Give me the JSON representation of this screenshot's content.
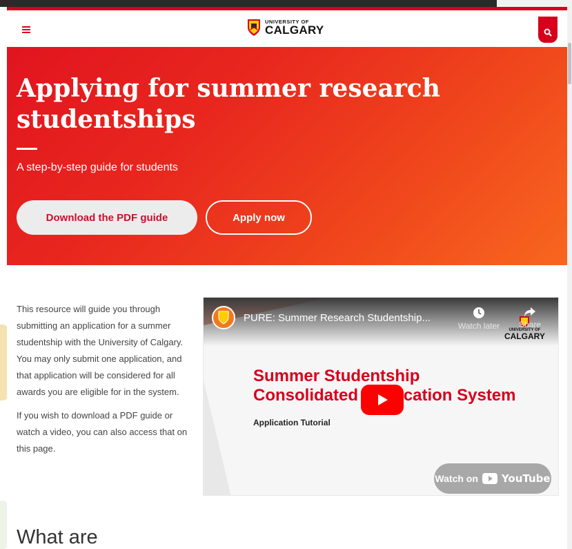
{
  "header": {
    "logo_small": "UNIVERSITY OF",
    "logo_big": "CALGARY"
  },
  "hero": {
    "title": "Applying for summer research studentships",
    "subtitle": "A step-by-step guide for students",
    "btn_pdf": "Download the PDF guide",
    "btn_apply": "Apply now"
  },
  "intro": {
    "p1": "This resource will guide you through submitting an application for a summer studentship with the University of Calgary. You may only submit one application, and that application will be considered for all awards you are eligible for in the system.",
    "p2": "If you wish to download a PDF guide or watch a video, you can also access that on this page."
  },
  "video": {
    "title": "PURE: Summer Research Studentship...",
    "watch_later": "Watch later",
    "share": "Share",
    "logo_small": "UNIVERSITY OF",
    "logo_big": "CALGARY",
    "heading_line1": "Summer Studentship",
    "heading_line2": "Consolidated Application System",
    "sub": "Application Tutorial",
    "watch_on": "Watch on",
    "youtube": "YouTube"
  },
  "section": {
    "heading": "What are"
  },
  "colors": {
    "brand_red": "#d6001c",
    "hero_start": "#e1141f",
    "hero_end": "#f8661f",
    "youtube_red": "#ff0000"
  }
}
